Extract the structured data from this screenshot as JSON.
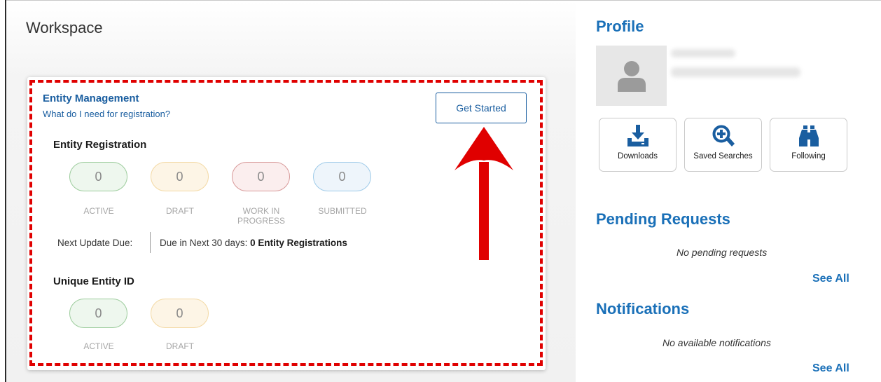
{
  "workspace": {
    "title": "Workspace",
    "card": {
      "title": "Entity Management",
      "link": "What do I need for registration?",
      "get_started": "Get Started",
      "registration": {
        "title": "Entity Registration",
        "statuses": [
          {
            "count": "0",
            "label": "ACTIVE"
          },
          {
            "count": "0",
            "label": "DRAFT"
          },
          {
            "count": "0",
            "label_line1": "WORK IN",
            "label_line2": "PROGRESS"
          },
          {
            "count": "0",
            "label": "SUBMITTED"
          }
        ],
        "next_update_label": "Next Update Due:",
        "due_prefix": "Due in Next 30 days:",
        "due_value": "0 Entity Registrations"
      },
      "uei": {
        "title": "Unique Entity ID",
        "statuses": [
          {
            "count": "0",
            "label": "ACTIVE"
          },
          {
            "count": "0",
            "label": "DRAFT"
          }
        ]
      }
    }
  },
  "profile": {
    "title": "Profile",
    "tiles": [
      {
        "label": "Downloads",
        "icon": "download-icon"
      },
      {
        "label": "Saved Searches",
        "icon": "search-plus-icon"
      },
      {
        "label": "Following",
        "icon": "binoculars-icon"
      }
    ]
  },
  "pending": {
    "title": "Pending Requests",
    "empty": "No pending requests",
    "see_all": "See All"
  },
  "notifications": {
    "title": "Notifications",
    "empty": "No available notifications",
    "see_all": "See All"
  },
  "colors": {
    "brand_blue": "#1a70b8",
    "link_blue": "#1a5ea0",
    "highlight_red": "#e00000"
  }
}
